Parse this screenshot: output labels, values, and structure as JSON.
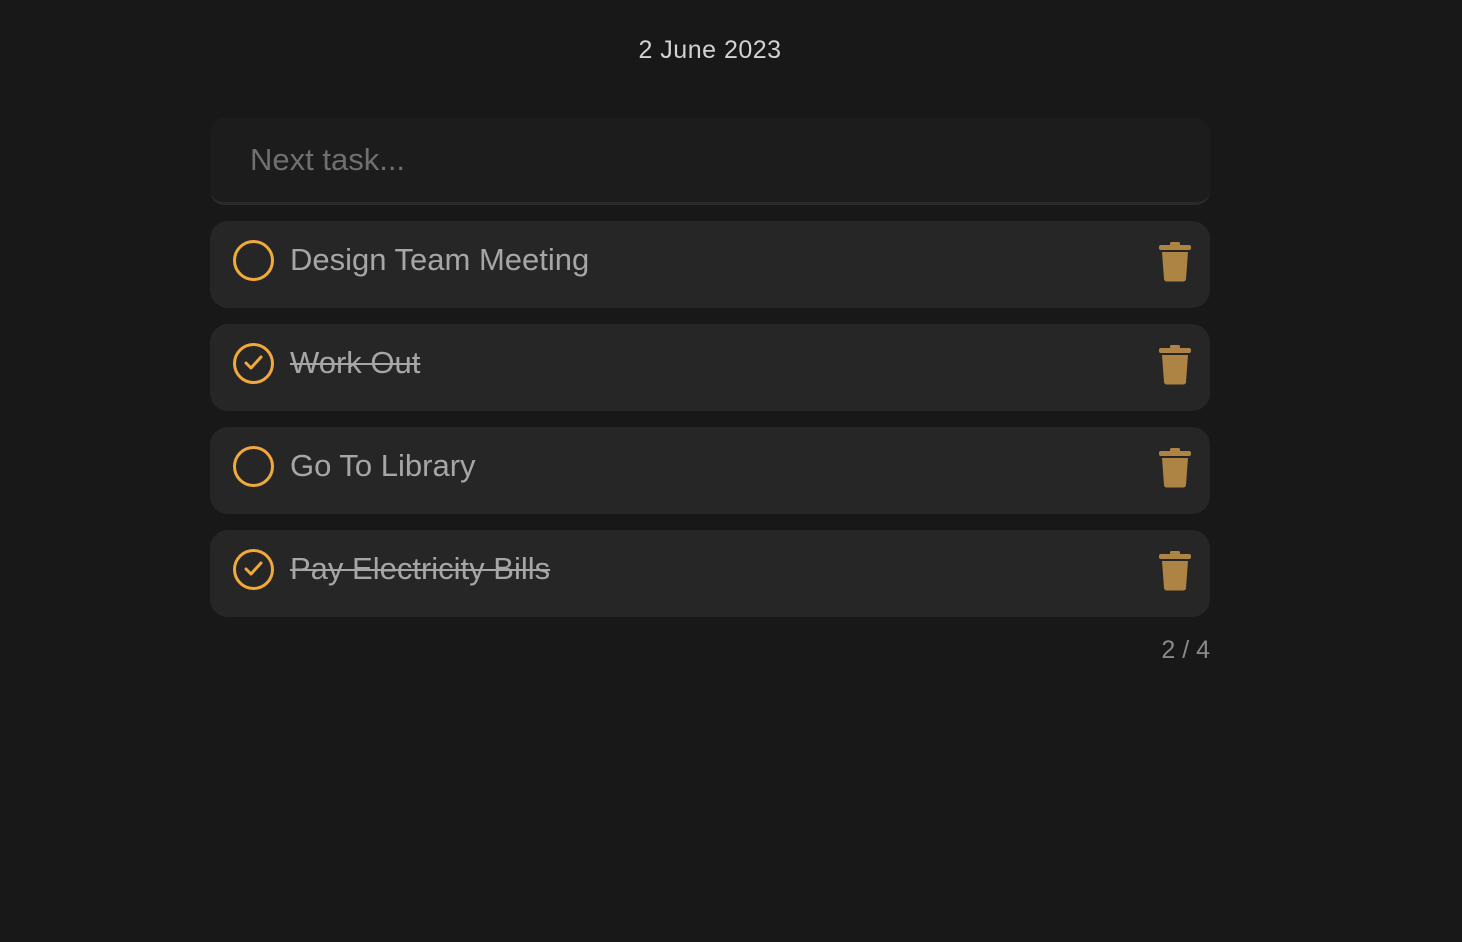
{
  "header": {
    "date": "2 June 2023"
  },
  "input": {
    "placeholder": "Next task...",
    "value": ""
  },
  "tasks": [
    {
      "label": "Design Team Meeting",
      "completed": false
    },
    {
      "label": "Work Out",
      "completed": true
    },
    {
      "label": "Go To Library",
      "completed": false
    },
    {
      "label": "Pay Electricity Bills",
      "completed": true
    }
  ],
  "footer": {
    "counter": "2 / 4"
  },
  "colors": {
    "accent": "#f0a93a",
    "trash": "#ad8443",
    "background": "#181818",
    "card": "#262626"
  },
  "icons": {
    "pending": "empty-circle-icon",
    "completed": "check-circle-icon",
    "delete": "trash-icon"
  }
}
